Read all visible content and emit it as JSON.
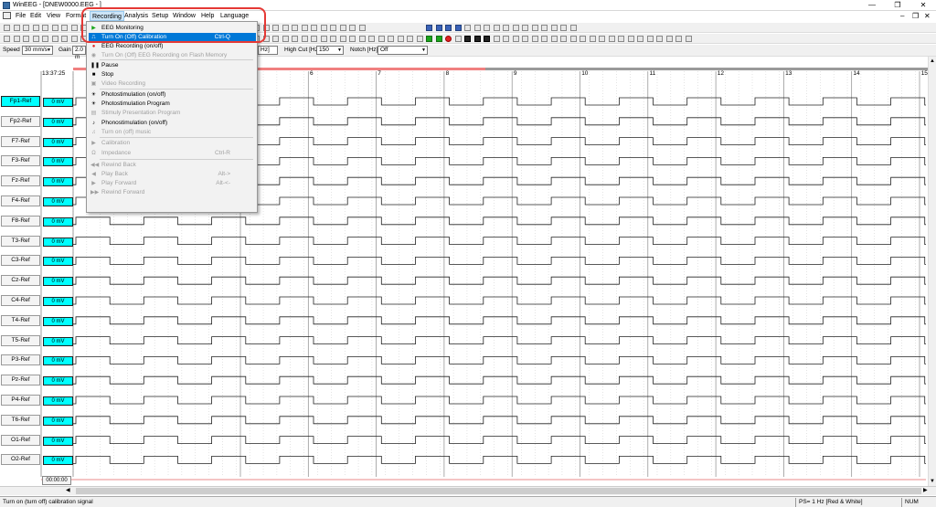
{
  "window": {
    "title": "WinEEG - [DNEW0000.EEG - ]",
    "minimize": "—",
    "restore": "❐",
    "close": "✕"
  },
  "menu": {
    "items": [
      "File",
      "Edit",
      "View",
      "Format",
      "Recording",
      "Analysis",
      "Setup",
      "Window",
      "Help",
      "Language"
    ],
    "active": "Recording",
    "mdi_minimize": "–",
    "mdi_restore": "❐",
    "mdi_close": "✕"
  },
  "recording_menu": {
    "items": [
      {
        "label": "EEG Monitoring",
        "shortcut": "",
        "icon": "play-green-icon",
        "enabled": true,
        "highlighted": false
      },
      {
        "label": "Turn On (Off) Calibration",
        "shortcut": "Ctrl-Q",
        "icon": "calibration-icon",
        "enabled": true,
        "highlighted": true
      },
      {
        "label": "EEG Recording (on/off)",
        "shortcut": "",
        "icon": "record-red-icon",
        "enabled": true,
        "highlighted": false
      },
      {
        "label": "Turn On (Off) EEG Recording on Flash Memory",
        "shortcut": "",
        "icon": "flash-record-icon",
        "enabled": false,
        "highlighted": false
      },
      {
        "label": "Pause",
        "shortcut": "",
        "icon": "pause-icon",
        "enabled": true,
        "highlighted": false
      },
      {
        "label": "Stop",
        "shortcut": "",
        "icon": "stop-icon",
        "enabled": true,
        "highlighted": false
      },
      {
        "label": "Video Recording",
        "shortcut": "",
        "icon": "video-icon",
        "enabled": false,
        "highlighted": false
      },
      {
        "label": "Photostimulation (on/off)",
        "shortcut": "",
        "icon": "photostim-icon",
        "enabled": true,
        "highlighted": false
      },
      {
        "label": "Photostimulation Program",
        "shortcut": "",
        "icon": "photostim-program-icon",
        "enabled": true,
        "highlighted": false
      },
      {
        "label": "Stimuly Presentation Program",
        "shortcut": "",
        "icon": "stimuli-icon",
        "enabled": false,
        "highlighted": false
      },
      {
        "label": "Phonostimulation (on/off)",
        "shortcut": "",
        "icon": "phonostim-icon",
        "enabled": true,
        "highlighted": false
      },
      {
        "label": "Turn on (off) music",
        "shortcut": "",
        "icon": "music-icon",
        "enabled": false,
        "highlighted": false
      },
      {
        "label": "Calibration",
        "shortcut": "",
        "icon": "calibration-play-icon",
        "enabled": false,
        "highlighted": false
      },
      {
        "label": "Impedance",
        "shortcut": "Ctrl-R",
        "icon": "impedance-icon",
        "enabled": false,
        "highlighted": false
      },
      {
        "label": "Rewind Back",
        "shortcut": "",
        "icon": "rewind-back-icon",
        "enabled": false,
        "highlighted": false
      },
      {
        "label": "Play Back",
        "shortcut": "Alt->",
        "icon": "play-back-icon",
        "enabled": false,
        "highlighted": false
      },
      {
        "label": "Play Forward",
        "shortcut": "Alt-<-",
        "icon": "play-forward-icon",
        "enabled": false,
        "highlighted": false
      },
      {
        "label": "Rewind Forward",
        "shortcut": "",
        "icon": "rewind-forward-icon",
        "enabled": false,
        "highlighted": false
      }
    ]
  },
  "settings": {
    "speed_label": "Speed",
    "speed_value": "30 mm/s",
    "gain_label": "Gain",
    "gain_value": "2.0 m",
    "highcut_label": "High Cut [Hz]",
    "highcut_value": "150",
    "notch_label": "Notch [Hz]",
    "notch_value": "Off",
    "lowcut_tail": "Hz]"
  },
  "timeline": {
    "start_time": "13:37:25",
    "second_marks": [
      "6",
      "7",
      "8",
      "9",
      "10",
      "11",
      "12",
      "13",
      "14",
      "15"
    ],
    "end_time": "00:00:00",
    "progress_fraction": 0.48
  },
  "channels": [
    {
      "name": "Fp1-Ref",
      "cal": "0 mV",
      "selected": true
    },
    {
      "name": "Fp2-Ref",
      "cal": "0 mV"
    },
    {
      "name": "F7-Ref",
      "cal": "0 mV"
    },
    {
      "name": "F3-Ref",
      "cal": "0 mV"
    },
    {
      "name": "Fz-Ref",
      "cal": "0 mV"
    },
    {
      "name": "F4-Ref",
      "cal": "0 mV"
    },
    {
      "name": "F8-Ref",
      "cal": "0 mV"
    },
    {
      "name": "T3-Ref",
      "cal": "0 mV"
    },
    {
      "name": "C3-Ref",
      "cal": "0 mV"
    },
    {
      "name": "Cz-Ref",
      "cal": "0 mV"
    },
    {
      "name": "C4-Ref",
      "cal": "0 mV"
    },
    {
      "name": "T4-Ref",
      "cal": "0 mV"
    },
    {
      "name": "T5-Ref",
      "cal": "0 mV"
    },
    {
      "name": "P3-Ref",
      "cal": "0 mV"
    },
    {
      "name": "Pz-Ref",
      "cal": "0 mV"
    },
    {
      "name": "P4-Ref",
      "cal": "0 mV"
    },
    {
      "name": "T6-Ref",
      "cal": "0 mV"
    },
    {
      "name": "O1-Ref",
      "cal": "0 mV"
    },
    {
      "name": "O2-Ref",
      "cal": "0 mV"
    }
  ],
  "status": {
    "message": "Turn on (turn off) calibration signal",
    "ps": "PS= 1 Hz [Red & White]",
    "num": "NUM"
  },
  "colors": {
    "highlight": "#0078d7",
    "cal_box": "#00ffff",
    "menu_active": "#cce4f7",
    "annotation_ring": "#e53935",
    "progress": "#f08080"
  }
}
